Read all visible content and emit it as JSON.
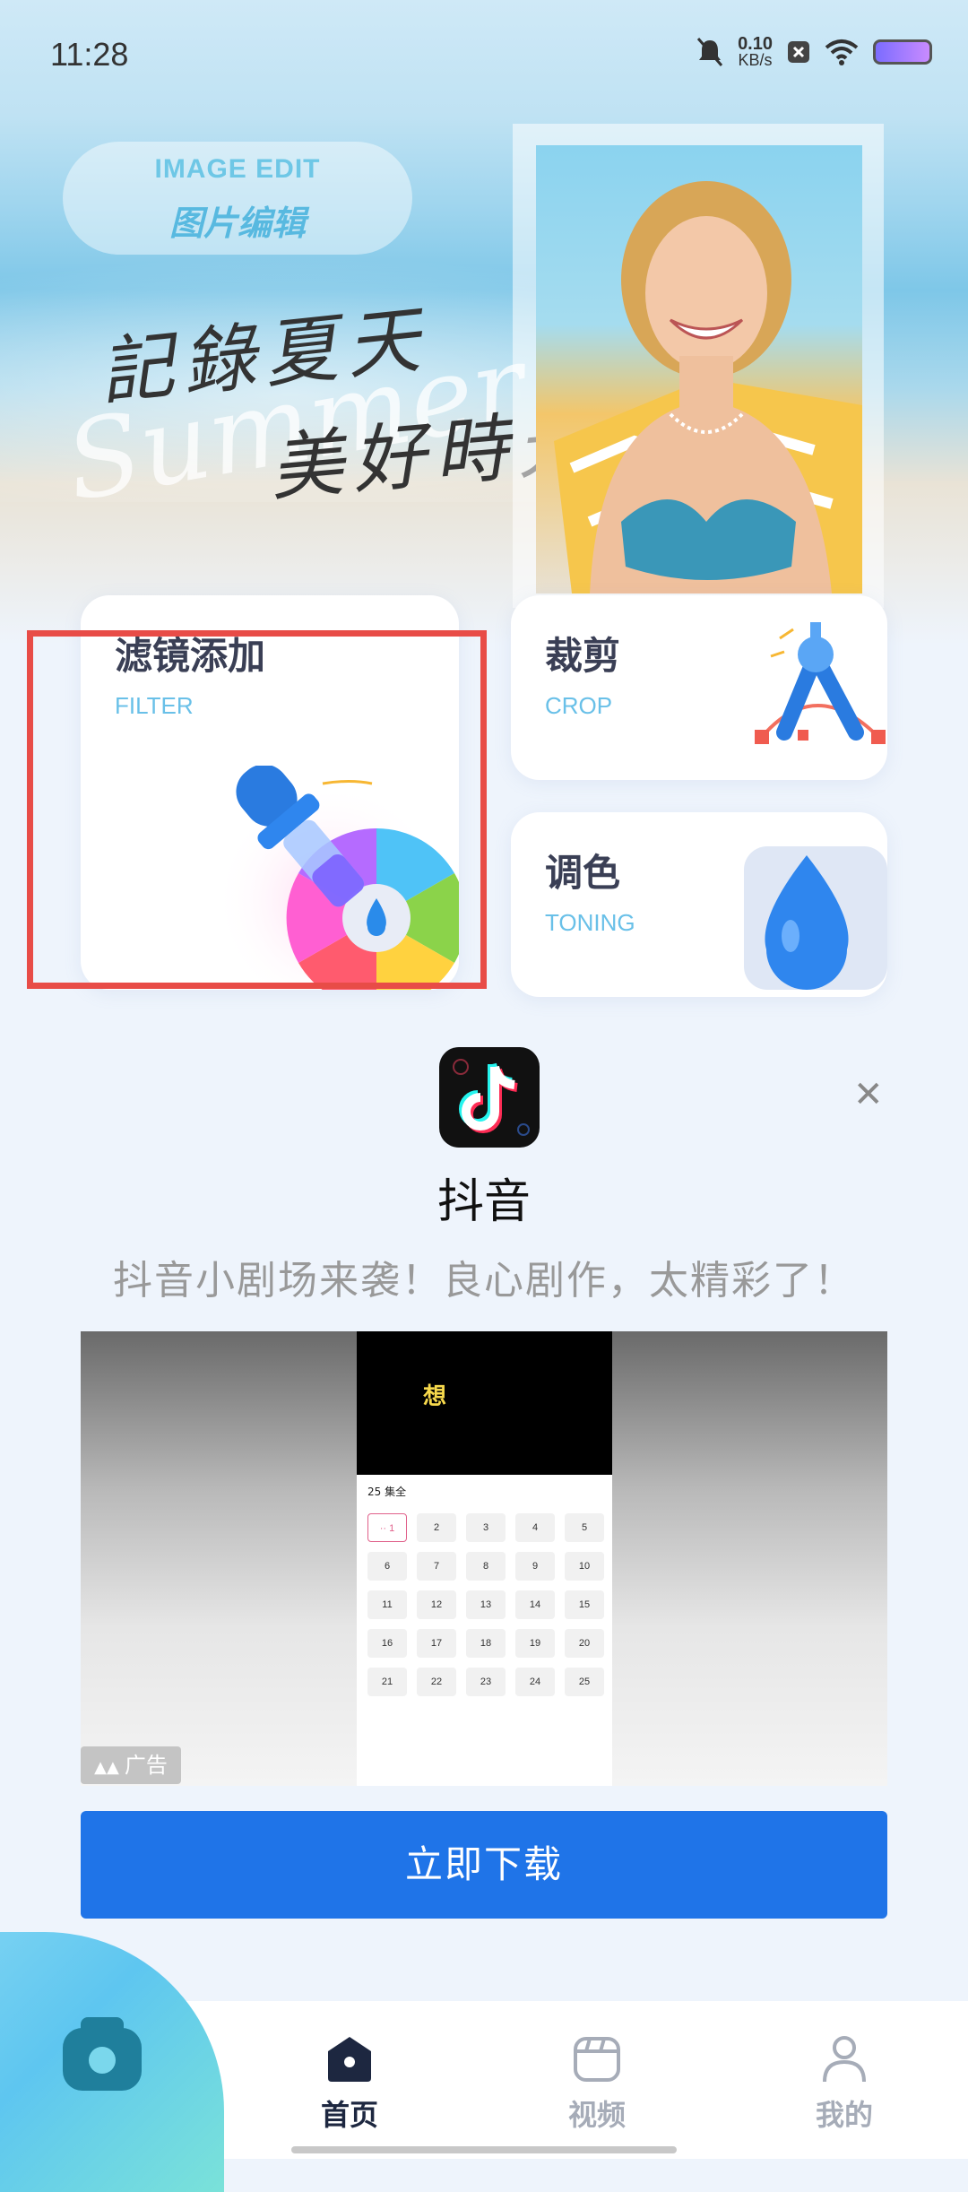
{
  "status_bar": {
    "time": "11:28",
    "net_speed_value": "0.10",
    "net_speed_unit": "KB/s"
  },
  "hero": {
    "badge_en": "IMAGE EDIT",
    "badge_zh": "图片编辑",
    "script_line1": "記錄夏天",
    "script_line2": "美好時光",
    "script_en": "Summer Day"
  },
  "features": [
    {
      "title": "滤镜添加",
      "subtitle": "FILTER"
    },
    {
      "title": "裁剪",
      "subtitle": "CROP"
    },
    {
      "title": "调色",
      "subtitle": "TONING"
    }
  ],
  "ad": {
    "app_name": "抖音",
    "description": "抖音小剧场来袭！良心剧作，太精彩了！",
    "media_overlay_char": "想",
    "episode_header": "25 集全",
    "episodes": [
      "·· 1",
      "2",
      "3",
      "4",
      "5",
      "6",
      "7",
      "8",
      "9",
      "10",
      "11",
      "12",
      "13",
      "14",
      "15",
      "16",
      "17",
      "18",
      "19",
      "20",
      "21",
      "22",
      "23",
      "24",
      "25"
    ],
    "ad_label": "广告",
    "cta": "立即下载"
  },
  "nav": {
    "items": [
      {
        "label": "首页",
        "active": true
      },
      {
        "label": "视频",
        "active": false
      },
      {
        "label": "我的",
        "active": false
      }
    ]
  },
  "colors": {
    "accent": "#1f74e8",
    "highlight": "#e84c47",
    "nav_active": "#1d2740",
    "nav_inactive": "#a6acb8"
  }
}
